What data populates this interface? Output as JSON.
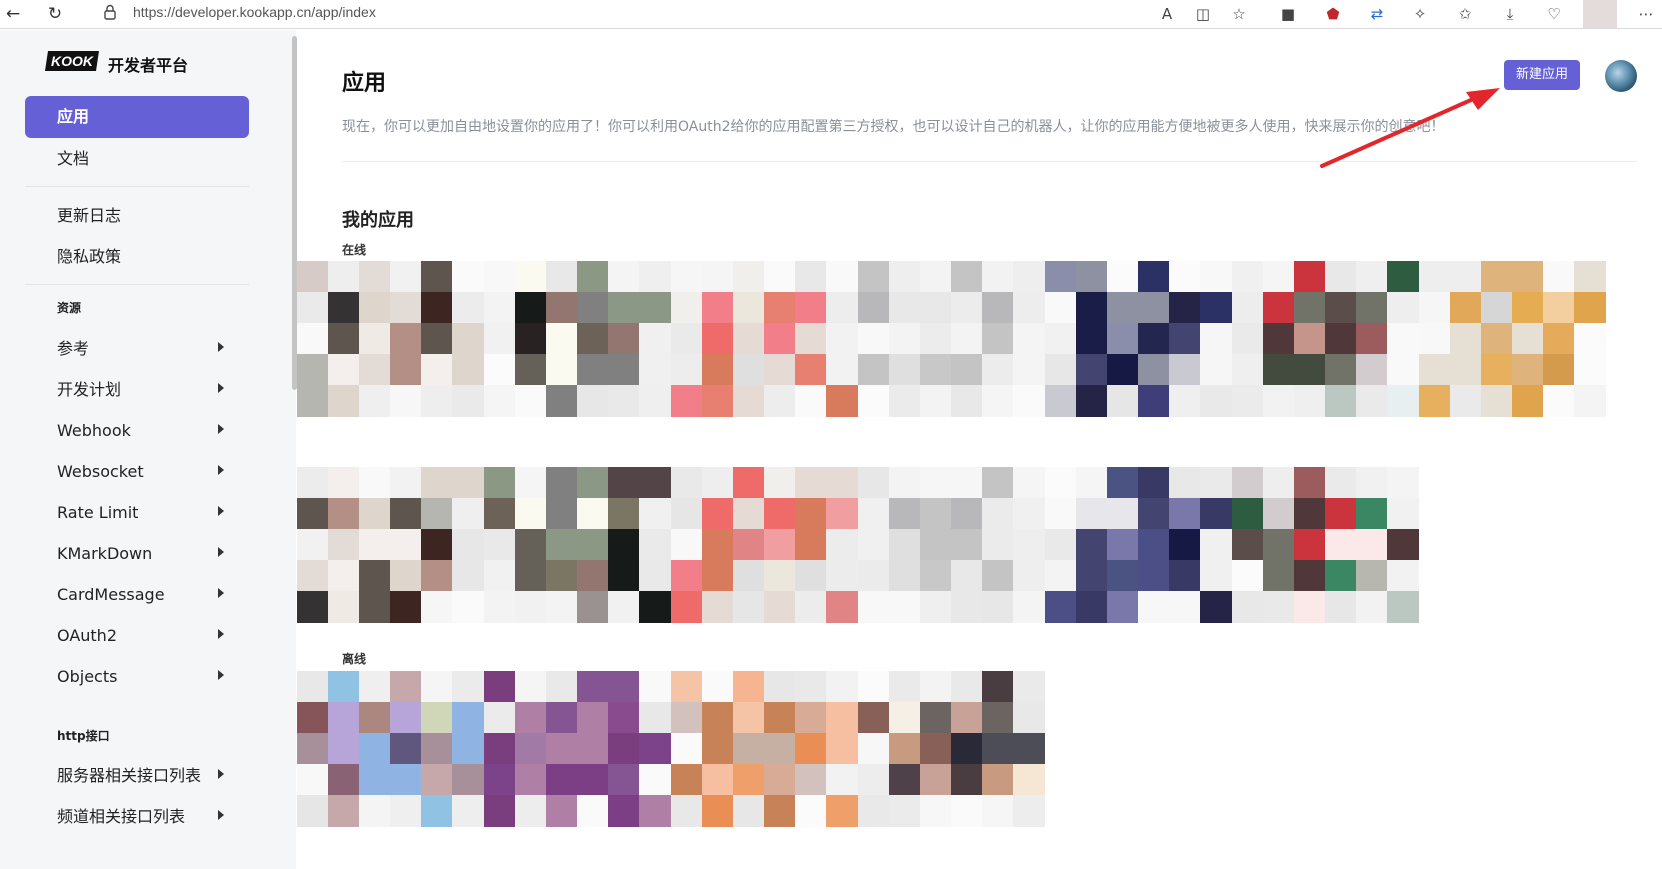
{
  "browser": {
    "url": "https://developer.kookapp.cn/app/index"
  },
  "sidebar": {
    "logo_text": "KOOK",
    "platform_name": "开发者平台",
    "items": [
      {
        "label": "应用",
        "active": true
      },
      {
        "label": "文档"
      },
      {
        "label": "更新日志"
      },
      {
        "label": "隐私政策"
      }
    ],
    "section_resources": "资源",
    "resource_items": [
      {
        "label": "参考"
      },
      {
        "label": "开发计划"
      },
      {
        "label": "Webhook"
      },
      {
        "label": "Websocket"
      },
      {
        "label": "Rate Limit"
      },
      {
        "label": "KMarkDown"
      },
      {
        "label": "CardMessage"
      },
      {
        "label": "OAuth2"
      },
      {
        "label": "Objects"
      }
    ],
    "section_http": "http接口",
    "http_items": [
      {
        "label": "服务器相关接口列表"
      },
      {
        "label": "频道相关接口列表"
      }
    ]
  },
  "main": {
    "title": "应用",
    "new_app_button": "新建应用",
    "description": "现在，你可以更加自由地设置你的应用了！你可以利用OAuth2给你的应用配置第三方授权，也可以设计自己的机器人，让你的应用能方便地被更多人使用，快来展示你的创意吧！",
    "my_apps_title": "我的应用",
    "online_label": "在线",
    "offline_label": "离线",
    "online_app_count": 13,
    "offline_app_count": 4
  },
  "colors": {
    "accent": "#6660d6",
    "annotation_arrow": "#e3262b"
  }
}
